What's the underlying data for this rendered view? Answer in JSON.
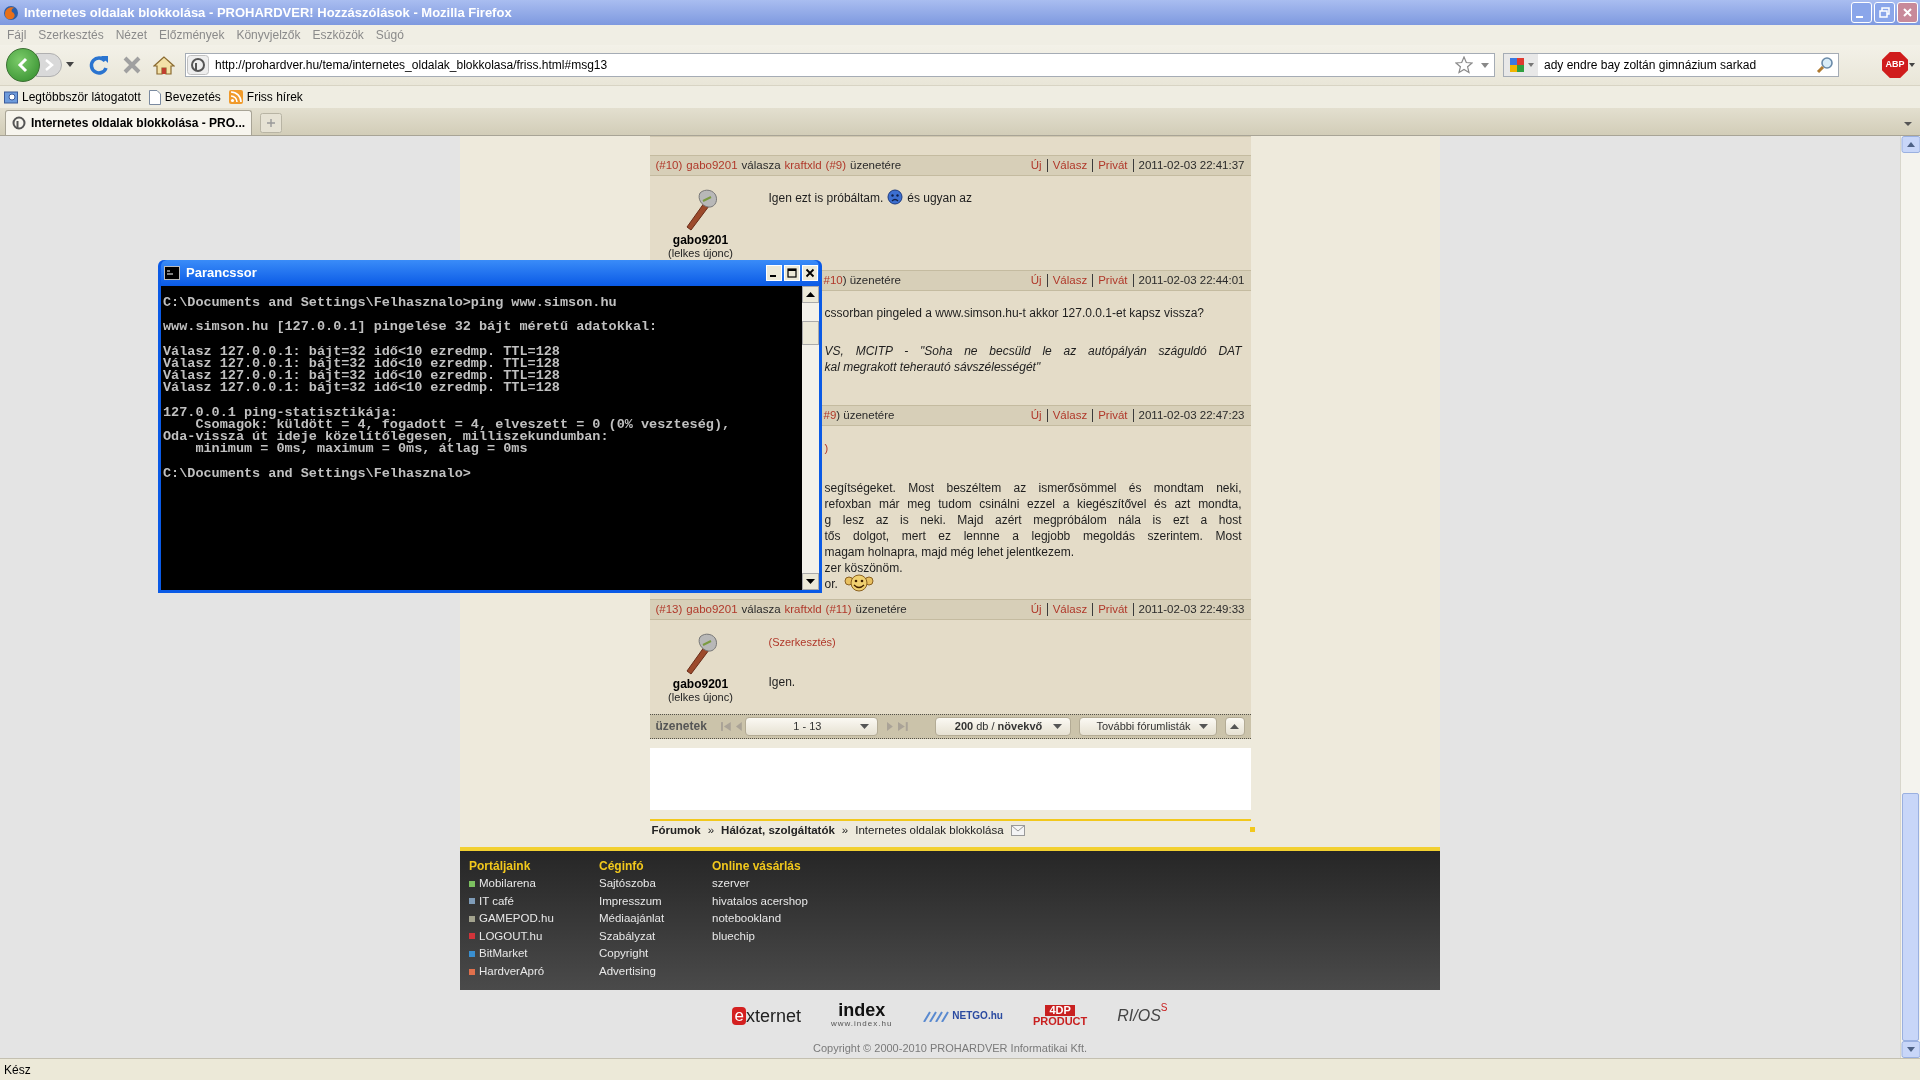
{
  "browser": {
    "title": "Internetes oldalak blokkolása - PROHARDVER! Hozzászólások - Mozilla Firefox",
    "active": false,
    "menu": [
      "Fájl",
      "Szerkesztés",
      "Nézet",
      "Előzmények",
      "Könyvjelzők",
      "Eszközök",
      "Súgó"
    ],
    "address": "http://prohardver.hu/tema/internetes_oldalak_blokkolasa/friss.html#msg13",
    "search": "ady endre bay zoltán gimnázium sarkad",
    "addon_badge": "ABP",
    "bookmarks": [
      {
        "label": "Legtöbbször látogatott",
        "kind": "smart"
      },
      {
        "label": "Bevezetés",
        "kind": "page"
      },
      {
        "label": "Friss hírek",
        "kind": "feed"
      }
    ],
    "tabs": [
      {
        "label": "Internetes oldalak blokkolása - PRO...",
        "selected": true
      }
    ],
    "status": "Kész"
  },
  "posts": [
    {
      "kind": "full",
      "header": [
        {
          "text": "(#10)",
          "link": true
        },
        {
          "text": "gabo9201",
          "link": true
        },
        {
          "text": "válasza",
          "link": false
        },
        {
          "text": "kraftxld",
          "link": true
        },
        {
          "text": "(#9)",
          "link": true
        },
        {
          "text": "üzenetére",
          "link": false
        }
      ],
      "actions": [
        "Új",
        "Válasz",
        "Privát"
      ],
      "time": "2011-02-03 22:41:37",
      "author": {
        "name": "gabo9201",
        "rank": "(lelkes újonc)"
      },
      "body": [
        {
          "kind": "plain",
          "lines": [
            {
              "parts": [
                {
                  "kind": "text",
                  "text": "Igen ezt is próbáltam."
                },
                {
                  "kind": "sad-smiley"
                },
                {
                  "kind": "text",
                  "text": "és ugyan az"
                }
              ]
            }
          ]
        }
      ]
    },
    {
      "kind": "partial",
      "header": [
        {
          "text": "#10",
          "link": true
        },
        {
          "text": ") üzenetére",
          "link": false
        }
      ],
      "actions": [
        "Új",
        "Válasz",
        "Privát"
      ],
      "time": "2011-02-03 22:44:01",
      "body": [
        {
          "kind": "plain",
          "lines": [
            {
              "parts": [
                {
                  "kind": "text",
                  "text": "cssorban pingeled a www.simson.hu-t akkor 127.0.0.1-et kapsz vissza?"
                }
              ]
            }
          ]
        },
        {
          "kind": "signature",
          "lines": [
            {
              "justified": true,
              "parts": [
                {
                  "kind": "text",
                  "text": "VS, MCITP - \"Soha ne becsüld le az autópályán száguldó DAT"
                }
              ]
            },
            {
              "parts": [
                {
                  "kind": "text",
                  "text": "kal megrakott teherautó sávszélességét\""
                }
              ]
            }
          ]
        }
      ]
    },
    {
      "kind": "partial",
      "header": [
        {
          "text": "#9",
          "link": true
        },
        {
          "text": ") üzenetére",
          "link": false
        }
      ],
      "actions": [
        "Új",
        "Válasz",
        "Privát"
      ],
      "time": "2011-02-03 22:47:23",
      "body": [
        {
          "kind": "edit",
          "lines": [
            {
              "parts": [
                {
                  "kind": "text",
                  "text": ")"
                }
              ]
            }
          ]
        },
        {
          "kind": "plain",
          "lines": [
            {
              "justified": true,
              "parts": [
                {
                  "kind": "text",
                  "text": "segítségeket. Most beszéltem az ismerősömmel és mondtam neki,"
                }
              ]
            },
            {
              "justified": true,
              "parts": [
                {
                  "kind": "text",
                  "text": "refoxban már meg tudom csinálni ezzel a kiegészítővel és azt mondta,"
                }
              ]
            },
            {
              "justified": true,
              "parts": [
                {
                  "kind": "text",
                  "text": "g lesz az is neki. Majd azért megpróbálom nála is ezt a host"
                }
              ]
            },
            {
              "justified": true,
              "parts": [
                {
                  "kind": "text",
                  "text": "tős dolgot, mert ez lennne a legjobb megoldás szerintem. Most"
                }
              ]
            },
            {
              "parts": [
                {
                  "kind": "text",
                  "text": "magam holnapra, majd még lehet jelentkezem."
                }
              ]
            },
            {
              "parts": [
                {
                  "kind": "text",
                  "text": "zer köszönöm."
                }
              ]
            },
            {
              "parts": [
                {
                  "kind": "text",
                  "text": "or."
                },
                {
                  "kind": "happy-smiley"
                }
              ]
            }
          ]
        }
      ]
    },
    {
      "kind": "full",
      "header": [
        {
          "text": "(#13)",
          "link": true
        },
        {
          "text": "gabo9201",
          "link": true
        },
        {
          "text": "válasza",
          "link": false
        },
        {
          "text": "kraftxld",
          "link": true
        },
        {
          "text": "(#11)",
          "link": true
        },
        {
          "text": "üzenetére",
          "link": false
        }
      ],
      "actions": [
        "Új",
        "Válasz",
        "Privát"
      ],
      "time": "2011-02-03 22:49:33",
      "author": {
        "name": "gabo9201",
        "rank": "(lelkes újonc)"
      },
      "body": [
        {
          "kind": "edit",
          "lines": [
            {
              "parts": [
                {
                  "kind": "text",
                  "text": "(Szerkesztés)"
                }
              ]
            }
          ]
        },
        {
          "kind": "plain",
          "lines": [
            {
              "parts": [
                {
                  "kind": "text",
                  "text": "Igen."
                }
              ]
            }
          ]
        }
      ]
    }
  ],
  "pager": {
    "label": "üzenetek",
    "range": "1 - 13",
    "order": "**200** db / **növekvő**",
    "more": "További fórumlisták"
  },
  "breadcrumb": [
    {
      "text": "Fórumok",
      "kind": "section"
    },
    {
      "text": "»",
      "kind": "separator"
    },
    {
      "text": "Hálózat, szolgáltatók",
      "kind": "section"
    },
    {
      "text": "»",
      "kind": "separator"
    },
    {
      "text": "Internetes oldalak blokkolása",
      "kind": "current"
    }
  ],
  "footer": {
    "columns": [
      {
        "title": "Portáljaink",
        "items": [
          {
            "label": "Mobilarena",
            "color": "#7cc060"
          },
          {
            "label": "IT café",
            "color": "#7f9cb8"
          },
          {
            "label": "GAMEPOD.hu",
            "color": "#a3a38e"
          },
          {
            "label": "LOGOUT.hu",
            "color": "#d0343a"
          },
          {
            "label": "BitMarket",
            "color": "#3a8fd0"
          },
          {
            "label": "HardverApró",
            "color": "#e0704c"
          }
        ]
      },
      {
        "title": "Céginfó",
        "items": [
          {
            "label": "Sajtószoba"
          },
          {
            "label": "Impresszum"
          },
          {
            "label": "Médiaajánlat"
          },
          {
            "label": "Szabályzat"
          },
          {
            "label": "Copyright"
          },
          {
            "label": "Advertising"
          }
        ]
      },
      {
        "title": "Online vásárlás",
        "items": [
          {
            "label": "szerver"
          },
          {
            "label": "hivatalos acershop"
          },
          {
            "label": "notebookland"
          },
          {
            "label": "bluechip"
          }
        ]
      }
    ]
  },
  "partners": [
    {
      "kind": "externet",
      "parts": [
        "e",
        "xternet"
      ]
    },
    {
      "kind": "index",
      "parts": [
        "index",
        "www.index.hu"
      ]
    },
    {
      "kind": "netgo",
      "parts": [
        "NETGO.hu"
      ]
    },
    {
      "kind": "product",
      "parts": [
        "4DP",
        "PRODUCT"
      ]
    },
    {
      "kind": "rios",
      "parts": [
        "RI/OS",
        "S"
      ]
    }
  ],
  "copyright": "Copyright © 2000-2010 PROHARDVER Informatikai Kft.",
  "console": {
    "title": "Parancssor",
    "active": true,
    "blocks": [
      [
        "C:\\Documents and Settings\\Felhasznalo>ping www.simson.hu"
      ],
      [
        "www.simson.hu [127.0.0.1] pingelése 32 bájt méretű adatokkal:"
      ],
      [
        "Válasz 127.0.0.1: bájt=32 idő<10 ezredmp. TTL=128",
        "Válasz 127.0.0.1: bájt=32 idő<10 ezredmp. TTL=128",
        "Válasz 127.0.0.1: bájt=32 idő<10 ezredmp. TTL=128",
        "Válasz 127.0.0.1: bájt=32 idő<10 ezredmp. TTL=128"
      ],
      [
        "127.0.0.1 ping-statisztikája:",
        "    Csomagok: küldött = 4, fogadott = 4, elveszett = 0 (0% veszteség),",
        "Oda-vissza út ideje közelítőlegesen, milliszekundumban:",
        "    minimum = 0ms, maximum = 0ms, átlag = 0ms"
      ],
      [
        "C:\\Documents and Settings\\Felhasznalo>"
      ]
    ]
  }
}
